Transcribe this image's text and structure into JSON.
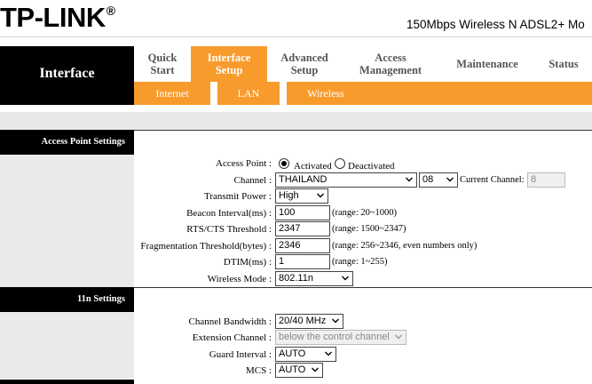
{
  "brand": {
    "logo_text": "TP-LINK",
    "registered": "®",
    "product_name": "150Mbps Wireless N ADSL2+ Mo"
  },
  "sidebar_title": "Interface",
  "nav": {
    "tabs": [
      {
        "line1": "Quick",
        "line2": "Start"
      },
      {
        "line1": "Interface",
        "line2": "Setup"
      },
      {
        "line1": "Advanced",
        "line2": "Setup"
      },
      {
        "line1": "Access",
        "line2": "Management"
      },
      {
        "line1": "Maintenance",
        "line2": ""
      },
      {
        "line1": "Status",
        "line2": ""
      }
    ],
    "subtabs": [
      "Internet",
      "LAN",
      "Wireless"
    ]
  },
  "colors": {
    "accent": "#f89b2d",
    "dark": "#000000",
    "panel_grey": "#eaeaea"
  },
  "ap": {
    "section": "Access Point Settings",
    "access_point_label": "Access Point :",
    "activated_label": "Activated",
    "deactivated_label": "Deactivated",
    "channel_label": "Channel :",
    "country": "THAILAND",
    "channel_value": "08",
    "current_channel_label": "Current Channel:",
    "current_channel_value": "8",
    "tx_power_label": "Transmit Power :",
    "tx_power_value": "High",
    "beacon_label": "Beacon Interval(ms) :",
    "beacon_value": "100",
    "beacon_range": "(range: 20~1000)",
    "rts_label": "RTS/CTS Threshold :",
    "rts_value": "2347",
    "rts_range": "(range: 1500~2347)",
    "frag_label": "Fragmentation Threshold(bytes) :",
    "frag_value": "2346",
    "frag_range": "(range: 256~2346, even numbers only)",
    "dtim_label": "DTIM(ms) :",
    "dtim_value": "1",
    "dtim_range": "(range: 1~255)",
    "mode_label": "Wireless Mode :",
    "mode_value": "802.11n"
  },
  "n11": {
    "section": "11n Settings",
    "bandwidth_label": "Channel Bandwidth :",
    "bandwidth_value": "20/40 MHz",
    "ext_label": "Extension Channel :",
    "ext_value": "below the control channel",
    "guard_label": "Guard Interval :",
    "guard_value": "AUTO",
    "mcs_label": "MCS :",
    "mcs_value": "AUTO"
  }
}
